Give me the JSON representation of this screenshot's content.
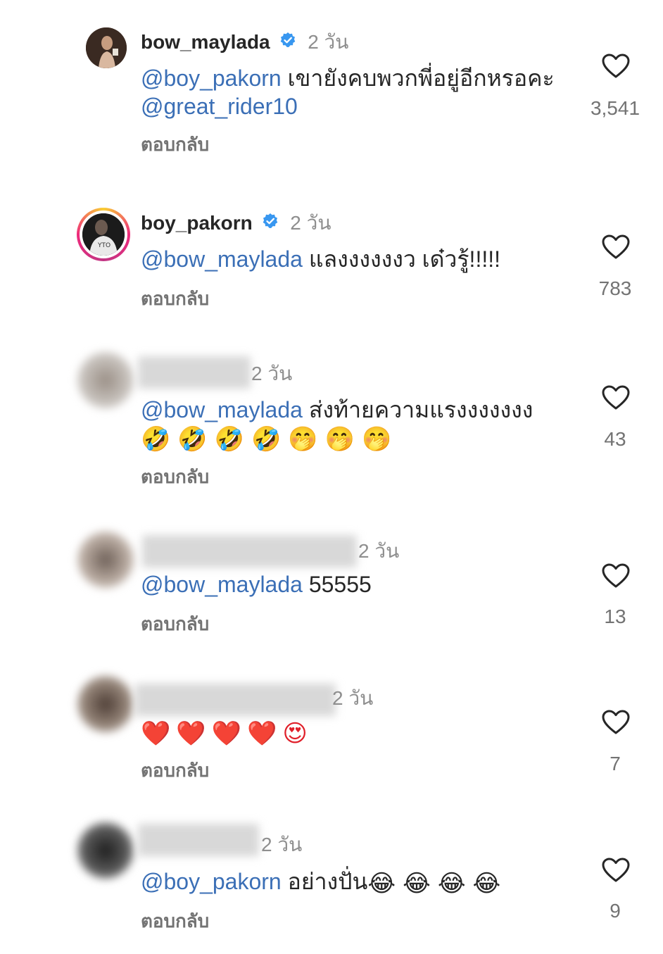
{
  "comments": [
    {
      "username": "bow_maylada",
      "verified": true,
      "time": "2 วัน",
      "mention": "@boy_pakorn",
      "text": " เขายังคบพวกพี่อยู่อีกหรอคะ",
      "line2_mention": "@great_rider10",
      "reply": "ตอบกลับ",
      "likes": "3,541"
    },
    {
      "username": "boy_pakorn",
      "verified": true,
      "time": "2 วัน",
      "mention": "@bow_maylada",
      "text": " แลงงงงงงว เด๋วรู้!!!!!",
      "reply": "ตอบกลับ",
      "likes": "783"
    },
    {
      "username_hidden": true,
      "time": "2 วัน",
      "mention": "@bow_maylada",
      "text": " ส่งท้ายความแรงงงงงงง",
      "emoji_line": "🤣🤣🤣🤣🤭🤭🤭",
      "reply": "ตอบกลับ",
      "likes": "43"
    },
    {
      "username_hidden": true,
      "time": "2 วัน",
      "mention": "@bow_maylada",
      "text": " 55555",
      "reply": "ตอบกลับ",
      "likes": "13"
    },
    {
      "username_hidden": true,
      "time": "2 วัน",
      "emoji_line": "❤️❤️❤️❤️😍",
      "reply": "ตอบกลับ",
      "likes": "7"
    },
    {
      "username_hidden": true,
      "time": "2 วัน",
      "mention": "@boy_pakorn",
      "text": " อย่างปั่น",
      "emoji_inline": "😂😂😂😂",
      "reply": "ตอบกลับ",
      "likes": "9"
    }
  ],
  "icons": {
    "like": "heart-outline-icon",
    "verified": "verified-badge-icon"
  },
  "colors": {
    "mention": "#3b6fb6",
    "muted": "#737373",
    "verified": "#3897f0"
  }
}
